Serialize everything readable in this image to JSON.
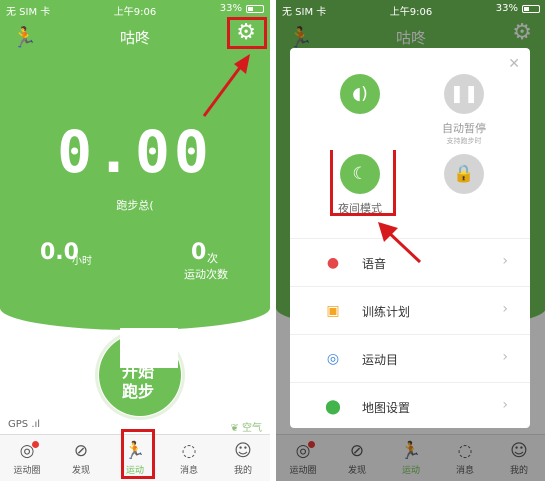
{
  "status_bar": {
    "carrier": "无 SIM 卡 ",
    "time": "上午9:06",
    "battery": "33%"
  },
  "header": {
    "title": "咕咚"
  },
  "home": {
    "total_distance": "0.00",
    "total_label": "跑步总(",
    "duration_value": "0.0",
    "duration_unit": "小时",
    "count_value": "0",
    "count_unit": "次",
    "count_label": "运动次数",
    "start_button": "开始跑步",
    "gps_label": "GPS",
    "air_label": "空气"
  },
  "tabs": [
    {
      "label": "运动圈",
      "icon": "circle-icon"
    },
    {
      "label": "发现",
      "icon": "compass-icon"
    },
    {
      "label": "运动",
      "icon": "runner-icon"
    },
    {
      "label": "消息",
      "icon": "message-icon"
    },
    {
      "label": "我的",
      "icon": "user-icon"
    }
  ],
  "settings_popup": {
    "auto_pause_label": "自动暂停",
    "auto_pause_sub": "支持跑步时",
    "night_mode_label": "夜间模式",
    "menu": [
      {
        "label": "语音",
        "icon": "voice-icon",
        "color": "#e54848"
      },
      {
        "label": "训练计划",
        "icon": "plan-icon",
        "color": "#f5a623"
      },
      {
        "label": "运动目",
        "icon": "target-icon",
        "color": "#3a86d8"
      },
      {
        "label": "地图设置",
        "icon": "map-pin-icon",
        "color": "#43b34b"
      }
    ]
  },
  "colors": {
    "brand_green": "#6fbf57",
    "highlight_red": "#d6191c"
  }
}
